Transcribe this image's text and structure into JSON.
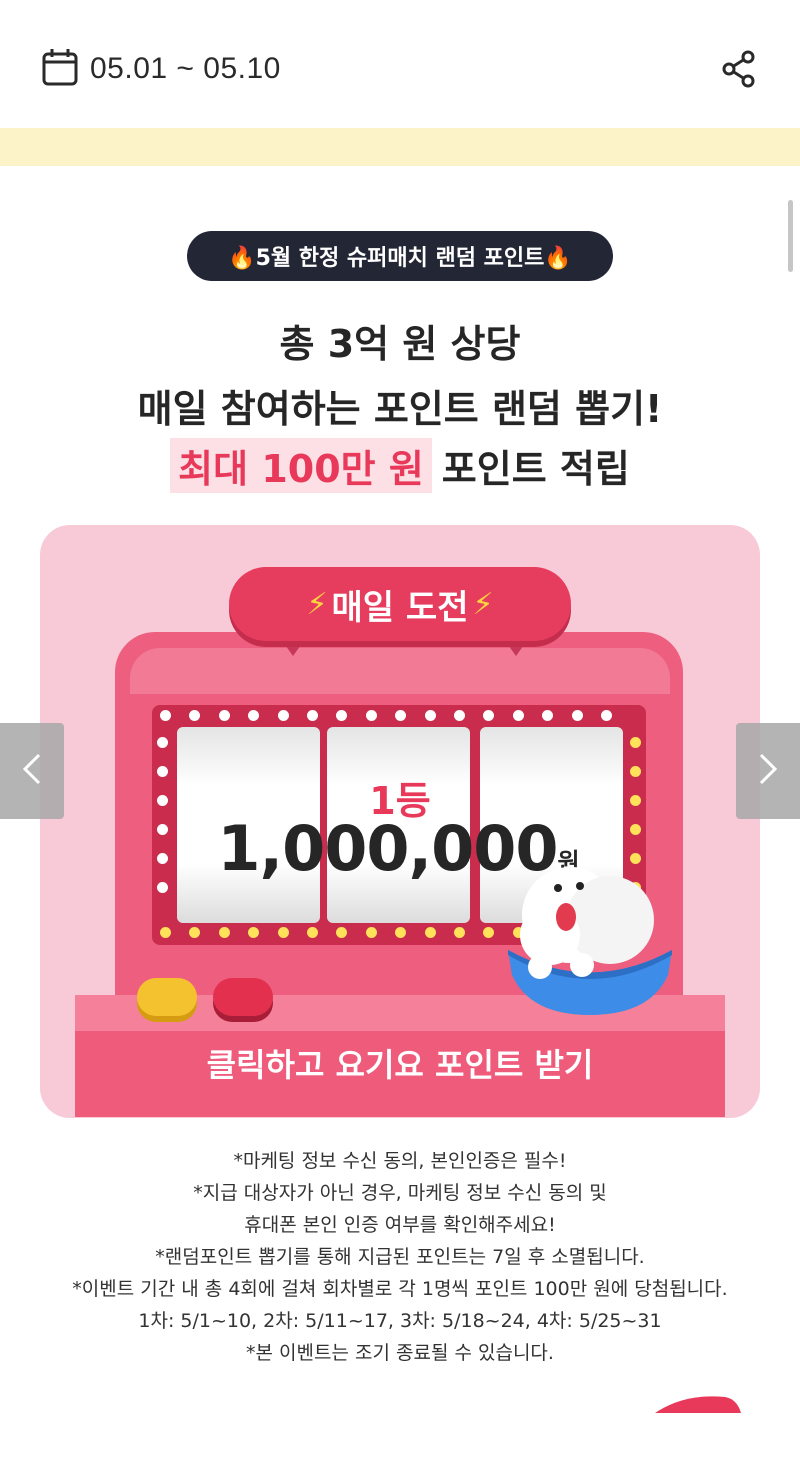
{
  "header": {
    "date_range": "05.01 ~ 05.10",
    "calendar_icon": "calendar-icon",
    "share_icon": "share-icon"
  },
  "event": {
    "badge": "🔥5월 한정 슈퍼매치 랜덤 포인트🔥",
    "headline_1": "총 3억 원 상당",
    "headline_2": "매일 참여하는 포인트 랜덤 뽑기!",
    "headline_3_highlight": "최대 100만 원",
    "headline_3_rest": "포인트 적립"
  },
  "machine": {
    "title": "매일 도전",
    "rank": "1등",
    "amount": "1,000,000",
    "currency": "원",
    "cta": "클릭하고 요기요 포인트 받기"
  },
  "carousel": {
    "prev_icon": "chevron-left-icon",
    "next_icon": "chevron-right-icon"
  },
  "notes": [
    "*마케팅 정보 수신 동의, 본인인증은 필수!",
    "*지급 대상자가 아닌 경우, 마케팅 정보 수신 동의 및",
    "휴대폰 본인 인증 여부를 확인해주세요!",
    "*랜덤포인트 뽑기를 통해 지급된 포인트는 7일 후 소멸됩니다.",
    "*이벤트 기간 내 총 4회에 걸쳐 회차별로 각 1명씩 포인트 100만 원에 당첨됩니다.",
    "1차: 5/1~10, 2차: 5/11~17, 3차: 5/18~24, 4차: 5/25~31",
    "*본 이벤트는 조기 종료될 수 있습니다."
  ],
  "colors": {
    "accent": "#e8395a",
    "panel": "#f8cad8",
    "band": "#fdf3c9",
    "badge_bg": "#232735"
  }
}
